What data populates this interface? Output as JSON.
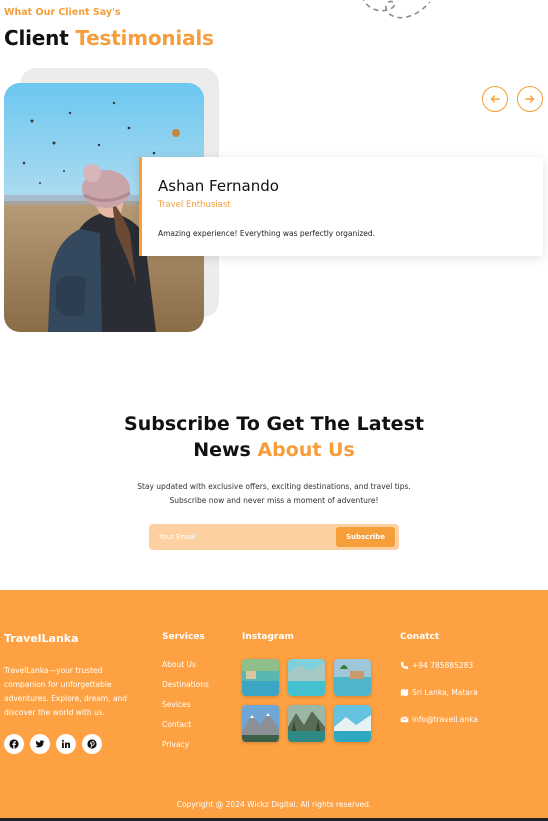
{
  "testimonials": {
    "eyebrow": "What Our Client Say's",
    "title_plain": "Client",
    "title_accent": "Testimonials",
    "prev_icon": "arrow-left-icon",
    "next_icon": "arrow-right-icon",
    "card": {
      "name": "Ashan Fernando",
      "role": "Travel Enthusiast",
      "text": "Amazing experience! Everything was perfectly organized."
    }
  },
  "subscribe": {
    "title_line1": "Subscribe To Get The Latest",
    "title_line2_plain": "News",
    "title_line2_accent": "About Us",
    "desc_line1": "Stay updated with exclusive offers, exciting destinations, and travel tips.",
    "desc_line2": "Subscribe now and never miss a moment of adventure!",
    "email_placeholder": "Your Email",
    "button_label": "Subscribe"
  },
  "footer": {
    "brand": "TravelLanka",
    "brand_desc": "TravelLanka—your trusted companion for unforgettable adventures. Explore, dream, and discover the world with us.",
    "socials": [
      "facebook-icon",
      "twitter-icon",
      "linkedin-icon",
      "pinterest-icon"
    ],
    "services_title": "Services",
    "services": [
      "About Us",
      "Destinations",
      "Sevices",
      "Contact",
      "Privacy"
    ],
    "instagram_title": "Instagram",
    "contact_title": "Conatct",
    "contact": {
      "phone": "+94 785885283",
      "location": "Sri Lanka, Matara",
      "email": "info@travell.anka"
    },
    "copyright": "Copyright @ 2024 Wickz Digital. All rights reserved."
  },
  "colors": {
    "accent": "#f59e3a",
    "footer_bg": "#fda142",
    "input_bg": "#fdd0a1"
  }
}
